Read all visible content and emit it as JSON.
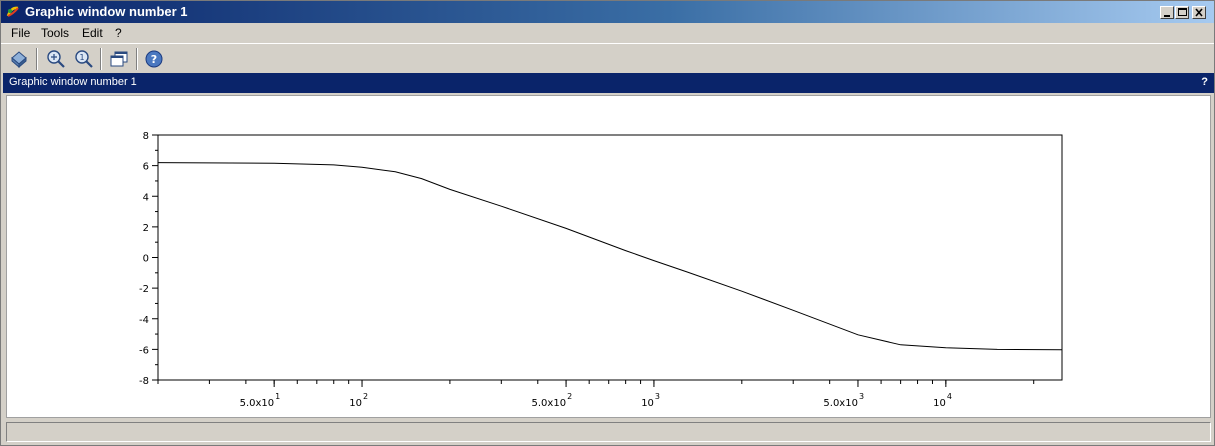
{
  "window": {
    "title": "Graphic window number 1"
  },
  "menu": {
    "items": [
      "File",
      "Tools",
      "Edit",
      "?"
    ]
  },
  "toolbar": {
    "buttons": [
      "rotate-icon",
      "zoom-in-icon",
      "zoom-reset-icon",
      "windows-icon",
      "help-icon"
    ]
  },
  "dock": {
    "title": "Graphic window number 1",
    "help_label": "?"
  },
  "chart_data": {
    "type": "line",
    "x_scale": "log",
    "xlim": [
      20,
      25000
    ],
    "ylim": [
      -8,
      8
    ],
    "y_ticks": [
      8,
      6,
      4,
      2,
      0,
      -2,
      -4,
      -6,
      -8
    ],
    "y_tick_labels": [
      "8",
      "6",
      "4",
      "2",
      "0",
      "-2",
      "-4",
      "-6",
      "-8"
    ],
    "x_tick_labels": [
      {
        "value": 50,
        "base": "5.0x10",
        "exp": "1"
      },
      {
        "value": 100,
        "base": "10",
        "exp": "2"
      },
      {
        "value": 500,
        "base": "5.0x10",
        "exp": "2"
      },
      {
        "value": 1000,
        "base": "10",
        "exp": "3"
      },
      {
        "value": 5000,
        "base": "5.0x10",
        "exp": "3"
      },
      {
        "value": 10000,
        "base": "10",
        "exp": "4"
      }
    ],
    "series": [
      {
        "x": [
          20,
          50,
          80,
          100,
          130,
          160,
          200,
          300,
          500,
          800,
          1000,
          1300,
          2000,
          3000,
          5000,
          7000,
          10000,
          15000,
          25000
        ],
        "values": [
          6.2,
          6.15,
          6.05,
          5.9,
          5.6,
          5.15,
          4.45,
          3.35,
          1.9,
          0.45,
          -0.2,
          -0.95,
          -2.2,
          -3.45,
          -5.05,
          -5.7,
          -5.9,
          -6.0,
          -6.02
        ]
      }
    ],
    "colors": {
      "line": "#000000",
      "frame": "#000000"
    }
  }
}
